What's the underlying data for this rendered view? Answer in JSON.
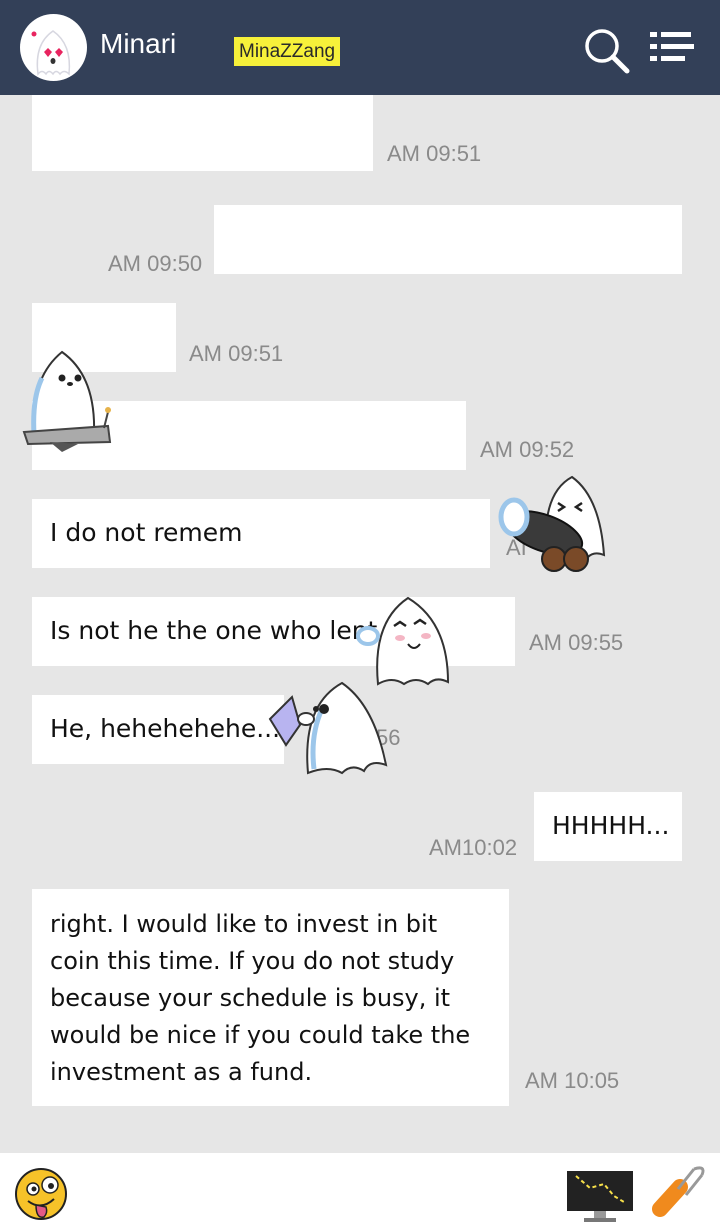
{
  "header": {
    "title": "Minari",
    "badge": "MinaZZang",
    "icons": [
      "avatar-ghost-icon",
      "search-icon",
      "menu-list-icon"
    ]
  },
  "messages": [
    {
      "side": "left",
      "text": "",
      "time": "AM 09:51"
    },
    {
      "side": "right",
      "text": "",
      "time": "AM 09:50"
    },
    {
      "side": "left",
      "text": "",
      "time": "AM 09:51"
    },
    {
      "side": "left",
      "text": "",
      "time": "AM 09:52"
    },
    {
      "side": "left",
      "text": "I do not remem",
      "time": ""
    },
    {
      "side": "left",
      "text": "Is not he the one who lent",
      "time": "AM 09:55"
    },
    {
      "side": "left",
      "text": "He, hehehehehe...",
      "time": ""
    },
    {
      "side": "right",
      "text": "HHHHH...",
      "time": "AM10:02"
    },
    {
      "side": "left",
      "text": "right. I would like to invest in bit coin this time. If you do not study because your schedule is busy, it would be nice if you could take the investment as a fund.",
      "time": "AM 10:05"
    }
  ],
  "partial_times": {
    "cannon": "AI",
    "pillow": "56"
  },
  "stickers": [
    "ghost-machine-sticker",
    "ghost-cannon-sticker",
    "ghost-laugh-sticker",
    "ghost-pillow-sticker"
  ],
  "footer": {
    "icons": [
      "emoji-face-icon",
      "monitor-icon",
      "paper-clip-icon"
    ]
  },
  "colors": {
    "header": "#334058",
    "background": "#e6e6e6",
    "badge": "#f7f13a"
  }
}
